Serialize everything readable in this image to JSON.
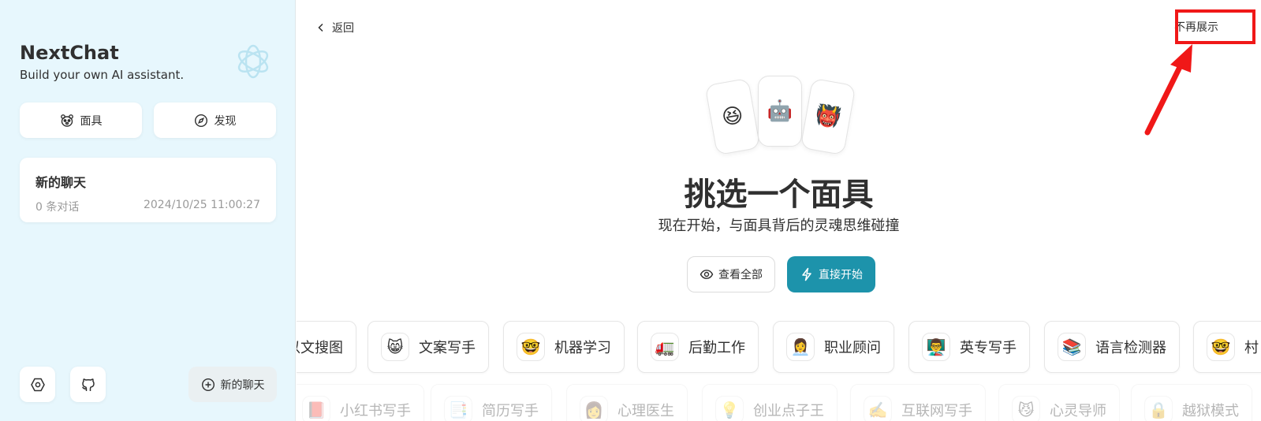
{
  "sidebar": {
    "title": "NextChat",
    "subtitle": "Build your own AI assistant.",
    "logo_icon": "openai-logo-icon",
    "masks_label": "面具",
    "discover_label": "发现",
    "chat": {
      "title": "新的聊天",
      "count": "0 条对话",
      "time": "2024/10/25 11:00:27"
    },
    "new_chat_label": "新的聊天"
  },
  "header": {
    "back_label": "返回",
    "dont_show_label": "不再展示"
  },
  "hero": {
    "emojis": [
      "😆",
      "🤖",
      "👹"
    ],
    "title": "挑选一个面具",
    "subtitle": "现在开始，与面具背后的灵魂思维碰撞",
    "view_all_label": "查看全部",
    "start_label": "直接开始"
  },
  "masks_row1": [
    {
      "emoji": "🖼️",
      "label": "以文搜图"
    },
    {
      "emoji": "😸",
      "label": "文案写手"
    },
    {
      "emoji": "🤓",
      "label": "机器学习"
    },
    {
      "emoji": "🚛",
      "label": "后勤工作"
    },
    {
      "emoji": "👩‍💼",
      "label": "职业顾问"
    },
    {
      "emoji": "👨‍🏫",
      "label": "英专写手"
    },
    {
      "emoji": "📚",
      "label": "语言检测器"
    },
    {
      "emoji": "🤓",
      "label": "村"
    }
  ],
  "masks_row2": [
    {
      "emoji": "📕",
      "label": "小红书写手"
    },
    {
      "emoji": "📑",
      "label": "简历写手"
    },
    {
      "emoji": "👩",
      "label": "心理医生"
    },
    {
      "emoji": "💡",
      "label": "创业点子王"
    },
    {
      "emoji": "✍️",
      "label": "互联网写手"
    },
    {
      "emoji": "😼",
      "label": "心灵导师"
    },
    {
      "emoji": "🔒",
      "label": "越狱模式"
    }
  ],
  "colors": {
    "sidebar_bg": "#e7f7fd",
    "primary": "#1d93ab",
    "annotation_red": "#f01818"
  }
}
